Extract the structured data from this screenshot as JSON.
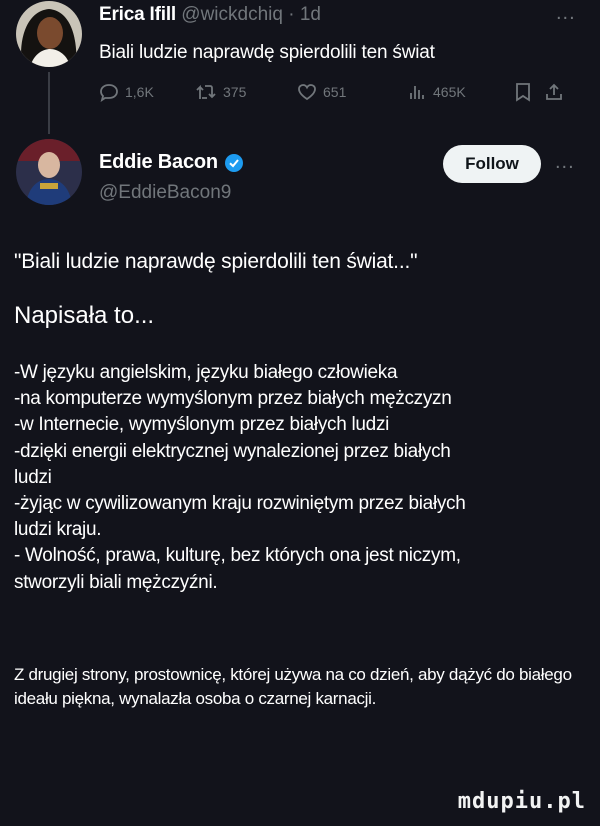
{
  "reply": {
    "author_name": "Erica Ifill",
    "author_handle": "@wickdchiq",
    "time": "1d",
    "menu": "...",
    "text": "Biali ludzie naprawdę spierdolili ten świat",
    "stats": {
      "replies": "1,6K",
      "retweets": "375",
      "likes": "651",
      "views": "465K"
    }
  },
  "main": {
    "author_name": "Eddie Bacon",
    "author_handle": "@EddieBacon9",
    "follow_label": "Follow",
    "menu": "...",
    "quote": "\"Biali ludzie naprawdę spierdolili ten świat...\"",
    "heading": "Napisała to...",
    "lines": [
      "-W języku angielskim, języku białego człowieka",
      "-na komputerze wymyślonym przez białych mężczyzn",
      "-w Internecie, wymyślonym przez białych ludzi",
      "-dzięki energii elektrycznej wynalezionej przez białych",
      "ludzi",
      "-żyjąc w cywilizowanym kraju rozwiniętym przez białych",
      "ludzi kraju.",
      "- Wolność, prawa, kulturę, bez których ona jest niczym,",
      "stworzyli biali mężczyźni."
    ],
    "closing": "Z drugiej strony, prostownicę, której używa na co dzień, aby dążyć do białego ideału piękna, wynalazła osoba o czarnej karnacji."
  },
  "watermark": "mdupiu.pl",
  "colors": {
    "background": "#12131b",
    "muted": "#71767b",
    "verified": "#1d9bf0",
    "follow_bg": "#eff3f4"
  },
  "icons": [
    "reply-icon",
    "retweet-icon",
    "like-icon",
    "views-icon",
    "bookmark-icon",
    "share-icon",
    "verified-icon"
  ]
}
